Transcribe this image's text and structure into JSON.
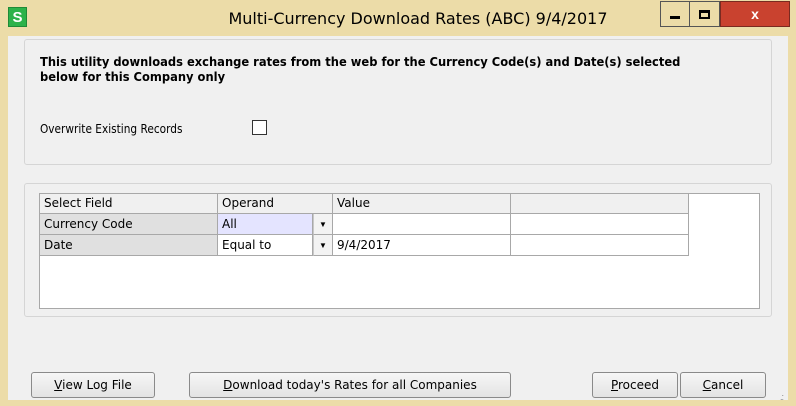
{
  "window": {
    "icon_letter": "S",
    "title": "Multi-Currency Download Rates (ABC) 9/4/2017",
    "close_glyph": "x"
  },
  "description": "This utility downloads exchange rates from the web for the Currency Code(s) and Date(s) selected below for this Company only",
  "overwrite": {
    "label": "Overwrite Existing Records",
    "checked": false
  },
  "grid": {
    "headers": [
      "Select Field",
      "Operand",
      "Value",
      ""
    ],
    "rows": [
      {
        "field": "Currency Code",
        "operand": "All",
        "value": ""
      },
      {
        "field": "Date",
        "operand": "Equal to",
        "value": "9/4/2017"
      }
    ],
    "dropdown_glyph": "▼"
  },
  "buttons": {
    "view_log": {
      "mnemonic": "V",
      "rest": "iew Log File"
    },
    "download": {
      "mnemonic": "D",
      "rest": "ownload today's Rates for all Companies"
    },
    "proceed": {
      "mnemonic": "P",
      "rest": "roceed"
    },
    "cancel": {
      "mnemonic": "C",
      "rest": "ancel"
    }
  },
  "colors": {
    "titlebar": "#ecdca8",
    "close": "#c9422f",
    "app_icon": "#2db24a",
    "selected_cell": "#e4e4ff"
  }
}
